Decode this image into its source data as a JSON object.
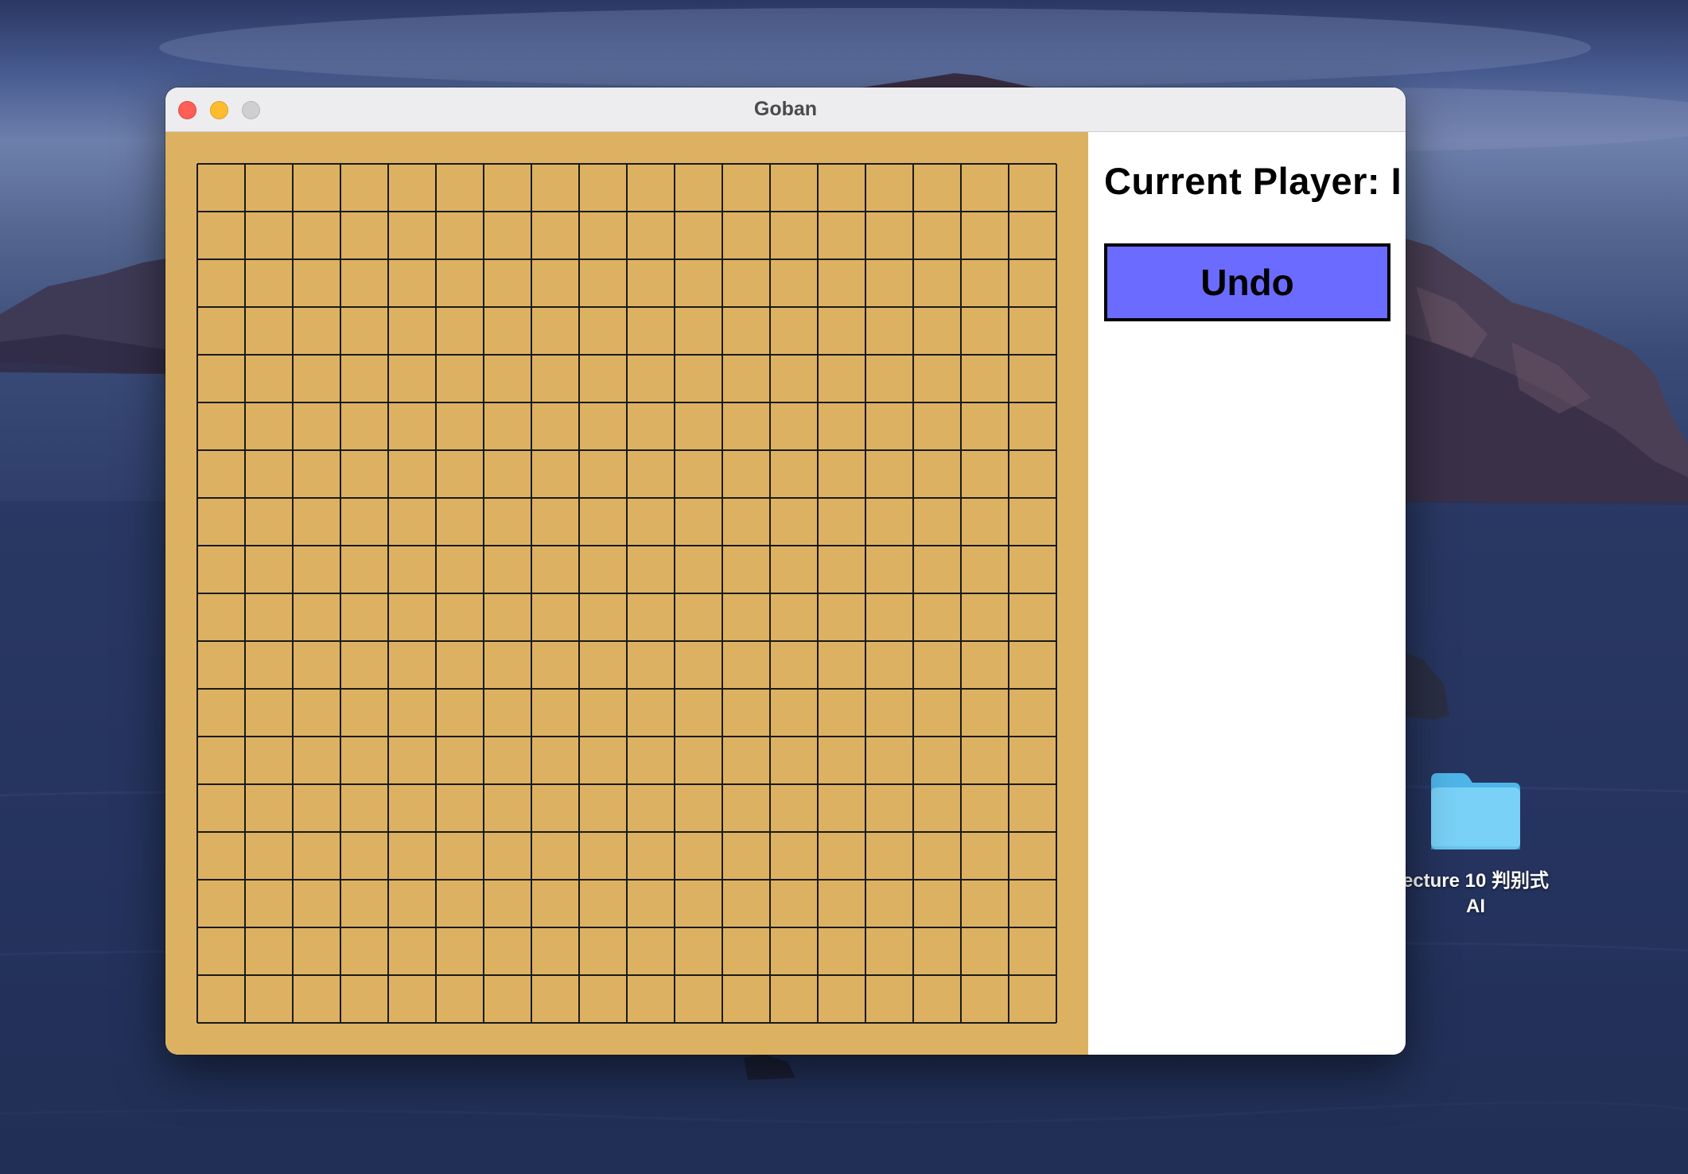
{
  "window": {
    "title": "Goban"
  },
  "board": {
    "size": 19,
    "background_color": "#dcb262",
    "line_color": "#1a1a1a",
    "stones": []
  },
  "side_panel": {
    "current_player_label": "Current Player: I",
    "undo_label": "Undo",
    "undo_color": "#6b6bff"
  },
  "desktop": {
    "folder": {
      "icon": "folder-icon",
      "label_line1": "ecture 10 判别式",
      "label_line2": "AI"
    }
  }
}
